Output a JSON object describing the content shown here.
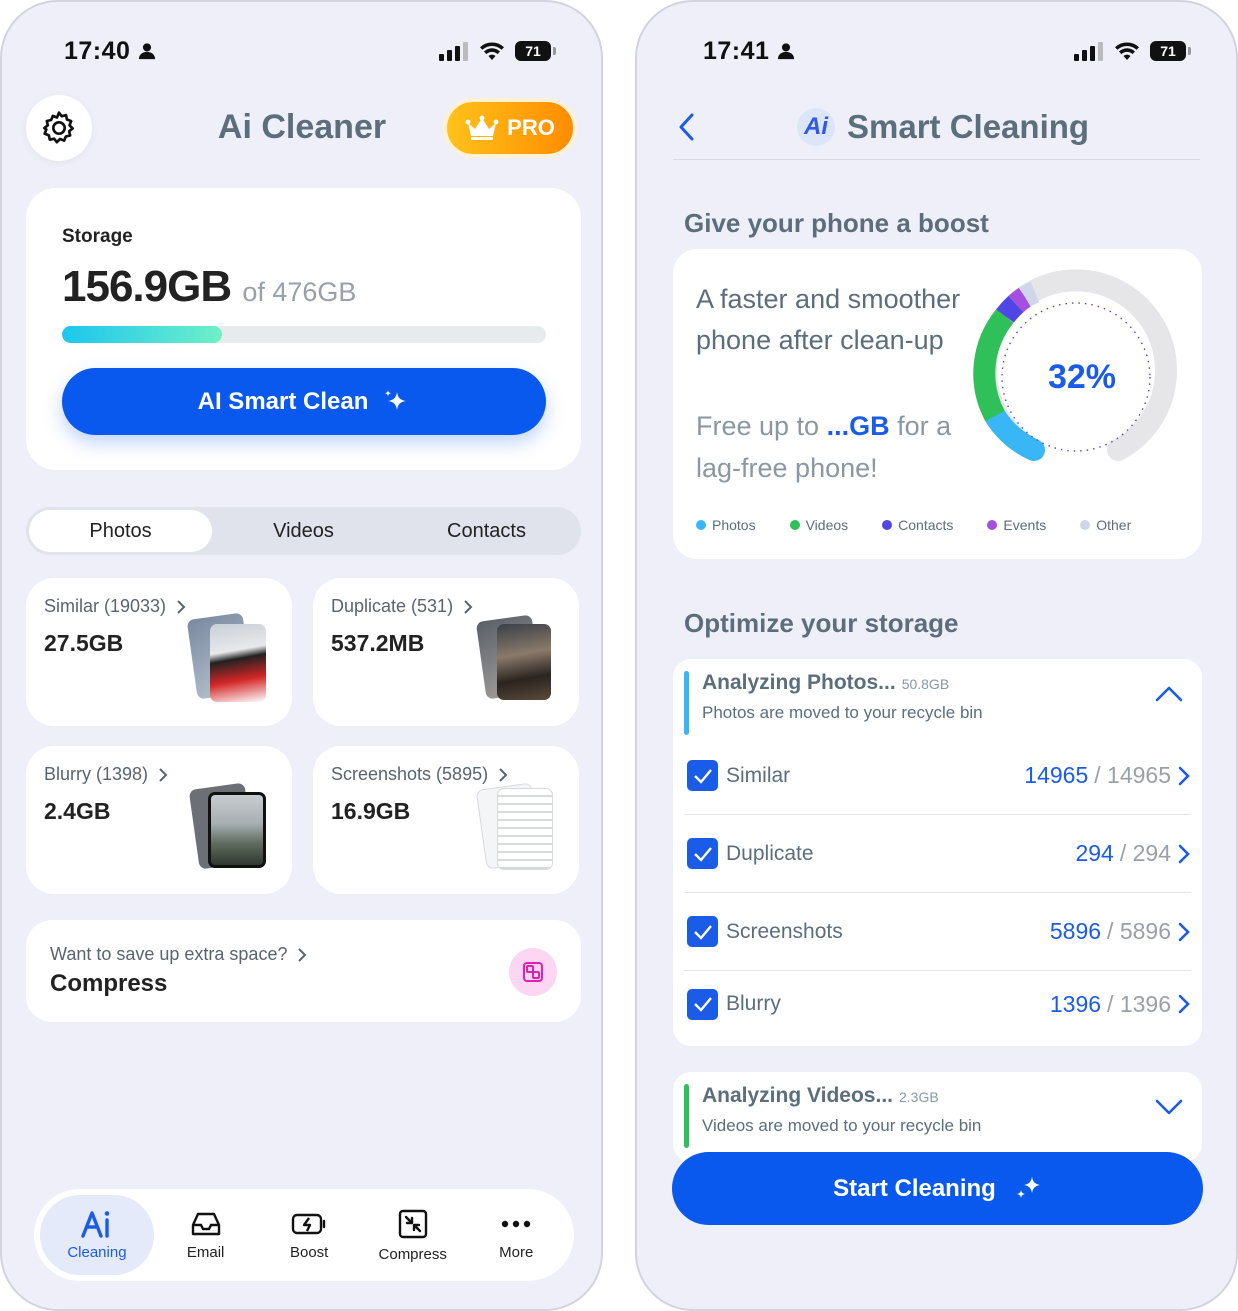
{
  "left": {
    "status": {
      "time": "17:40",
      "battery": "71"
    },
    "header": {
      "title": "Ai Cleaner",
      "pro_label": "PRO"
    },
    "storage": {
      "label": "Storage",
      "used": "156.9GB",
      "total": "of 476GB",
      "fill_fraction": 0.33,
      "clean_button": "AI Smart Clean"
    },
    "tabs": [
      {
        "label": "Photos",
        "active": true
      },
      {
        "label": "Videos"
      },
      {
        "label": "Contacts"
      }
    ],
    "tiles": [
      {
        "label": "Similar (19033)",
        "size": "27.5GB"
      },
      {
        "label": "Duplicate (531)",
        "size": "537.2MB"
      },
      {
        "label": "Blurry (1398)",
        "size": "2.4GB"
      },
      {
        "label": "Screenshots (5895)",
        "size": "16.9GB"
      }
    ],
    "compress": {
      "question": "Want to save up extra space?",
      "title": "Compress"
    },
    "nav": [
      {
        "label": "Cleaning",
        "icon": "ai-icon",
        "active": true
      },
      {
        "label": "Email",
        "icon": "inbox-icon"
      },
      {
        "label": "Boost",
        "icon": "battery-bolt-icon"
      },
      {
        "label": "Compress",
        "icon": "compress-icon"
      },
      {
        "label": "More",
        "icon": "more-icon"
      }
    ]
  },
  "right": {
    "status": {
      "time": "17:41",
      "battery": "71"
    },
    "header": {
      "title": "Smart Cleaning",
      "badge": "Ai"
    },
    "boost": {
      "section_title": "Give your phone a boost",
      "text": "A faster and smoother phone after clean-up",
      "free_prefix": "Free up to ",
      "free_value": "...GB",
      "free_suffix": " for a lag-free phone!",
      "percent": "32%",
      "legend": [
        {
          "name": "Photos",
          "color": "#39b6f5"
        },
        {
          "name": "Videos",
          "color": "#2fc05a"
        },
        {
          "name": "Contacts",
          "color": "#5046e5"
        },
        {
          "name": "Events",
          "color": "#a44fe0"
        },
        {
          "name": "Other",
          "color": "#cfd6ea"
        }
      ]
    },
    "optimize": {
      "section_title": "Optimize your storage",
      "photos_head": {
        "title": "Analyzing Photos...",
        "size": "50.8GB",
        "subtitle": "Photos are moved to your recycle bin"
      },
      "rows": [
        {
          "name": "Similar",
          "selected": "14965",
          "total": " / 14965"
        },
        {
          "name": "Duplicate",
          "selected": "294",
          "total": " / 294"
        },
        {
          "name": "Screenshots",
          "selected": "5896",
          "total": " / 5896"
        },
        {
          "name": "Blurry",
          "selected": "1396",
          "total": " / 1396"
        }
      ],
      "videos_head": {
        "title": "Analyzing Videos...",
        "size": "2.3GB",
        "subtitle": "Videos are moved to your recycle bin"
      }
    },
    "start_button": "Start Cleaning"
  },
  "colors": {
    "accent": "#0a59ee",
    "pro_gradient_start": "#ffc21a",
    "pro_gradient_end": "#ff8c00",
    "title_gray": "#5b6e7c"
  }
}
